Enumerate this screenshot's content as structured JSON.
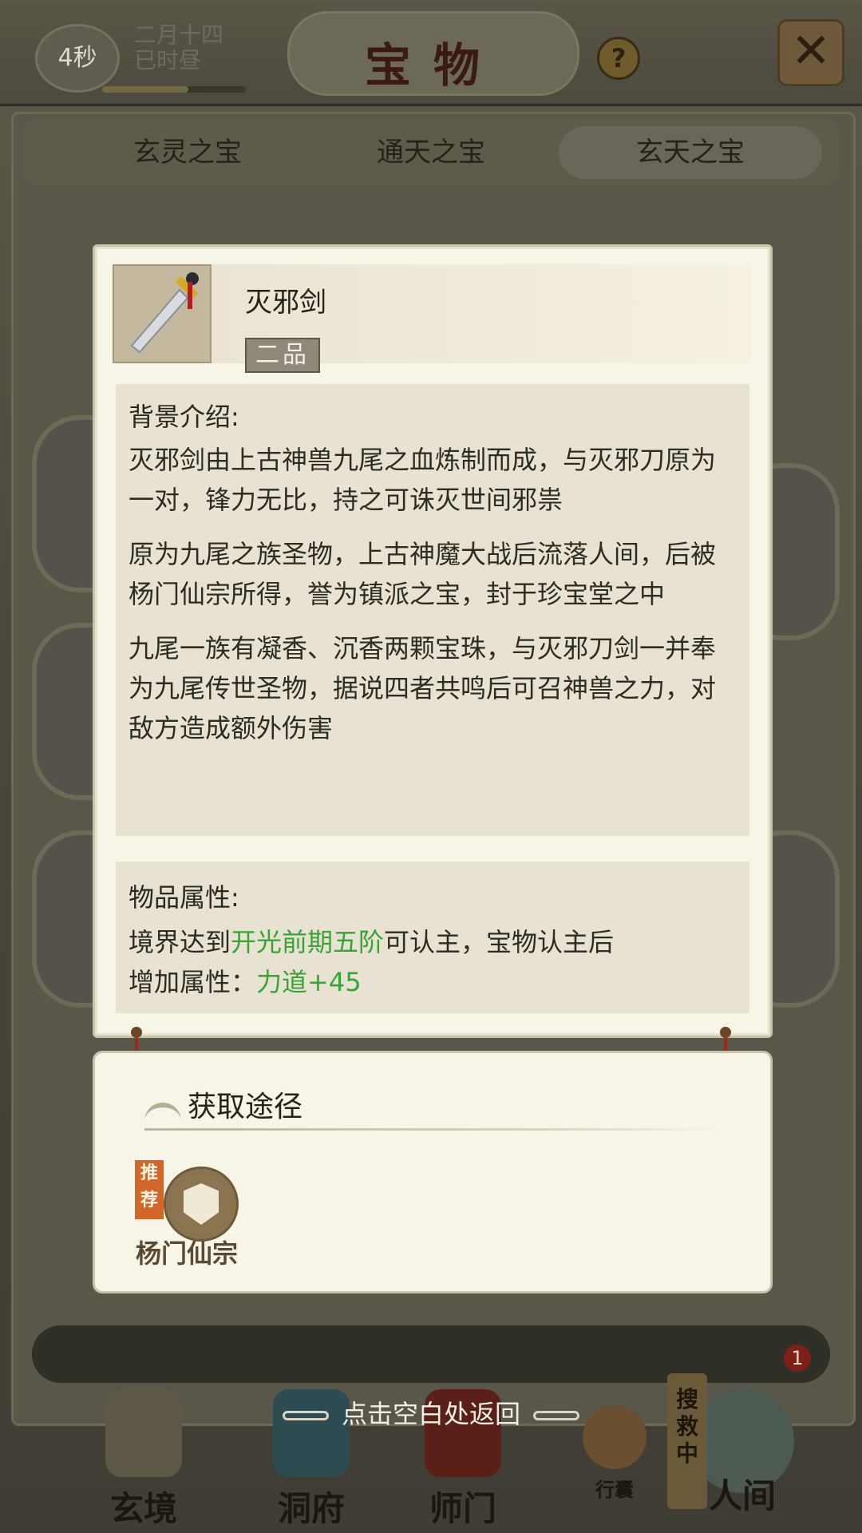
{
  "header": {
    "timer": "4秒",
    "date_line1": "二月十四",
    "date_line2": "已时昼",
    "title": "宝物",
    "help": "?"
  },
  "tabs": [
    "玄灵之宝",
    "通天之宝",
    "玄天之宝"
  ],
  "item": {
    "name": "灭邪剑",
    "grade": "二品",
    "background_title": "背景介绍:",
    "paragraphs": [
      "灭邪剑由上古神兽九尾之血炼制而成，与灭邪刀原为一对，锋力无比，持之可诛灭世间邪祟",
      "原为九尾之族圣物，上古神魔大战后流落人间，后被杨门仙宗所得，誉为镇派之宝，封于珍宝堂之中",
      "九尾一族有凝香、沉香两颗宝珠，与灭邪刀剑一并奉为九尾传世圣物，据说四者共鸣后可召神兽之力，对敌方造成额外伤害"
    ],
    "attr_title": "物品属性:",
    "attr_prefix": "境界达到",
    "attr_realm": "开光前期五阶",
    "attr_suffix": "可认主，宝物认主后",
    "attr_line2_prefix": "增加属性：",
    "attr_bonus": "力道+45"
  },
  "acquisition": {
    "title": "获取途径",
    "recommend": "推荐",
    "source": "杨门仙宗"
  },
  "return_hint": "点击空白处返回",
  "bottom_nav": {
    "items": [
      "玄境",
      "洞府",
      "师门",
      "行囊",
      "人间"
    ],
    "searching": "搜救中",
    "badge": "1"
  }
}
